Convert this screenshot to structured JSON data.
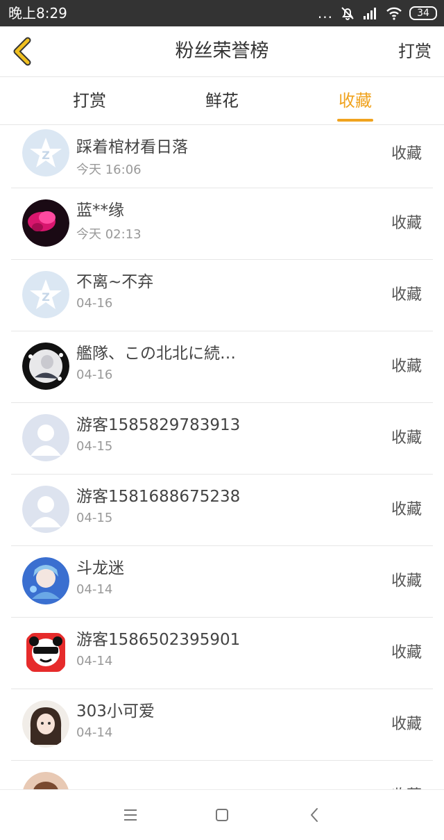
{
  "status_bar": {
    "time": "晚上8:29",
    "dots": "...",
    "battery": "34",
    "icons": [
      "mute-bell-icon",
      "signal-icon",
      "wifi-icon",
      "battery-icon"
    ]
  },
  "header": {
    "title": "粉丝荣誉榜",
    "action": "打赏",
    "back_icon": "chevron-left-icon",
    "back_color": "#f0c020"
  },
  "tabs": [
    {
      "label": "打赏",
      "active": false
    },
    {
      "label": "鲜花",
      "active": false
    },
    {
      "label": "收藏",
      "active": true
    }
  ],
  "accent_color": "#f0a31f",
  "rows": [
    {
      "name": "踩着棺材看日落",
      "date": "今天 16:06",
      "action": "收藏",
      "avatar": "default-star"
    },
    {
      "name": "蓝**缘",
      "date": "今天 02:13",
      "action": "收藏",
      "avatar": "flower-photo"
    },
    {
      "name": "不离~不弃",
      "date": "04-16",
      "action": "收藏",
      "avatar": "default-star"
    },
    {
      "name": "艦隊、この北北に続…",
      "date": "04-16",
      "action": "收藏",
      "avatar": "anime-dark"
    },
    {
      "name": "游客1585829783913",
      "date": "04-15",
      "action": "收藏",
      "avatar": "default-person"
    },
    {
      "name": "游客1581688675238",
      "date": "04-15",
      "action": "收藏",
      "avatar": "default-person"
    },
    {
      "name": "斗龙迷",
      "date": "04-14",
      "action": "收藏",
      "avatar": "anime-blue"
    },
    {
      "name": "游客1586502395901",
      "date": "04-14",
      "action": "收藏",
      "avatar": "panda-cartoon"
    },
    {
      "name": "303小可爱",
      "date": "04-14",
      "action": "收藏",
      "avatar": "anime-girl"
    },
    {
      "name": "",
      "date": "",
      "action": "收藏",
      "avatar": "photo-partial"
    }
  ],
  "nav": [
    "menu-icon",
    "home-icon",
    "back-icon"
  ]
}
